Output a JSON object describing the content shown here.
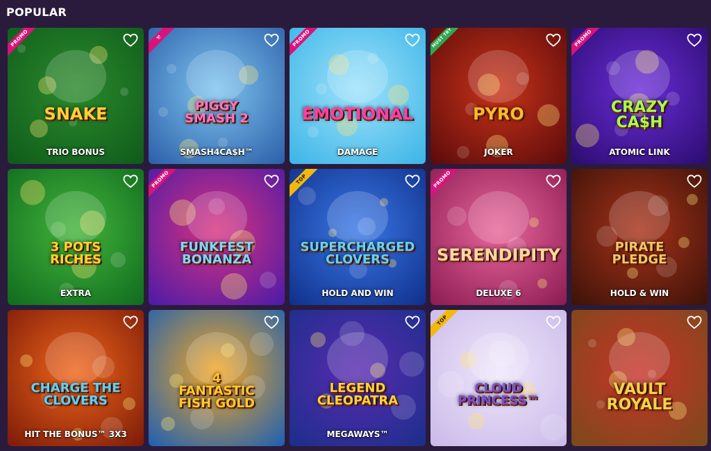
{
  "section": {
    "title": "POPULAR"
  },
  "games": [
    {
      "title": "SNAKE",
      "subtitle": "TRIO BONUS",
      "badge": "PROMO",
      "badge_type": "promo",
      "bg": [
        "#0e5a1a",
        "#2b8a2c"
      ],
      "title_color": "#ffcf3a"
    },
    {
      "title": "PIGGY\nSMASH 2",
      "subtitle": "SMASH4CA$H™",
      "badge": "",
      "badge_type": "hammer",
      "bg": [
        "#2a5ea8",
        "#7fc4ef"
      ],
      "title_color": "#ff72c8"
    },
    {
      "title": "EMOTIONAL",
      "subtitle": "DAMAGE",
      "badge": "PROMO",
      "badge_type": "promo",
      "bg": [
        "#3ab4e6",
        "#9fe2fb"
      ],
      "title_color": "#ff3fa8"
    },
    {
      "title": "PYRO",
      "subtitle": "JOKER",
      "badge": "MUST TRY",
      "badge_type": "must",
      "bg": [
        "#5a0a0a",
        "#c8331a"
      ],
      "title_color": "#ffb92b"
    },
    {
      "title": "CRAZY\nCA$H",
      "subtitle": "ATOMIC LINK",
      "badge": "PROMO",
      "badge_type": "promo",
      "bg": [
        "#2b0c6e",
        "#6a2cd8"
      ],
      "title_color": "#a7ff4a"
    },
    {
      "title": "3 POTS\nRICHES",
      "subtitle": "EXTRA",
      "badge": "",
      "badge_type": "",
      "bg": [
        "#0f6a1e",
        "#43b43a"
      ],
      "title_color": "#ffd52e"
    },
    {
      "title": "FUNKFEST\nBONANZA",
      "subtitle": "",
      "badge": "PROMO",
      "badge_type": "promo",
      "bg": [
        "#4a1aa8",
        "#d9337e"
      ],
      "title_color": "#7ad9ff"
    },
    {
      "title": "SUPERCHARGED\nCLOVERS",
      "subtitle": "HOLD AND WIN",
      "badge": "TOP",
      "badge_type": "top",
      "bg": [
        "#0f2f8a",
        "#3a78e6"
      ],
      "title_color": "#5fd3ff"
    },
    {
      "title": "SERENDIPITY",
      "subtitle": "deluxe 6",
      "badge": "PROMO",
      "badge_type": "promo",
      "bg": [
        "#8a1a52",
        "#e8679a"
      ],
      "title_color": "#ffd8a0"
    },
    {
      "title": "PIRATE\nPLEDGE",
      "subtitle": "HOLD & WIN",
      "badge": "",
      "badge_type": "",
      "bg": [
        "#3a1208",
        "#a8321a"
      ],
      "title_color": "#f4c56a"
    },
    {
      "title": "CHARGE THE\nCLOVERS",
      "subtitle": "HIT the BONUS™ 3x3",
      "badge": "",
      "badge_type": "",
      "bg": [
        "#7a1a08",
        "#f0651a"
      ],
      "title_color": "#5ad2ff"
    },
    {
      "title": "4\nFANTASTIC\nFISH GOLD",
      "subtitle": "",
      "badge": "",
      "badge_type": "",
      "bg": [
        "#1a5fb4",
        "#f5a623"
      ],
      "title_color": "#ffca2e"
    },
    {
      "title": "LEGEND\nCLEOPATRA",
      "subtitle": "MEGAWAYS™",
      "badge": "",
      "badge_type": "",
      "bg": [
        "#1a2f8a",
        "#5a2ab0"
      ],
      "title_color": "#ffd23a"
    },
    {
      "title": "CLOUD\nPRINCESS™",
      "subtitle": "",
      "badge": "TOP",
      "badge_type": "top",
      "bg": [
        "#c9b9e8",
        "#efe6fb"
      ],
      "title_color": "#7a4fd8"
    },
    {
      "title": "VAULT\nROYALE",
      "subtitle": "",
      "badge": "",
      "badge_type": "",
      "bg": [
        "#7a4a1a",
        "#c8332a"
      ],
      "title_color": "#f4d14a"
    }
  ]
}
